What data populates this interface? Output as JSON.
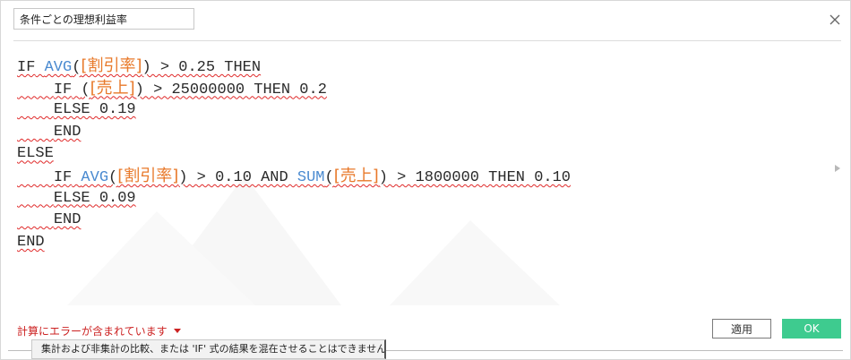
{
  "dialog": {
    "name_value": "条件ごとの理想利益率",
    "close_label": "×"
  },
  "code_lines": [
    [
      {
        "t": "IF",
        "c": "kw"
      },
      {
        "t": " "
      },
      {
        "t": "AVG",
        "c": "fn"
      },
      {
        "t": "(",
        "c": "kw"
      },
      {
        "t": "[割引率]",
        "c": "br"
      },
      {
        "t": ") > 0.25 THEN",
        "c": "kw"
      }
    ],
    [
      {
        "t": "    "
      },
      {
        "t": "IF",
        "c": "kw"
      },
      {
        "t": " "
      },
      {
        "t": "(",
        "c": "kw"
      },
      {
        "t": "[売上]",
        "c": "br"
      },
      {
        "t": ") > 25000000 THEN 0.2",
        "c": "kw"
      }
    ],
    [
      {
        "t": "    "
      },
      {
        "t": "ELSE 0.19",
        "c": "kw"
      }
    ],
    [
      {
        "t": "    "
      },
      {
        "t": "END",
        "c": "kw"
      }
    ],
    [
      {
        "t": "ELSE",
        "c": "kw"
      }
    ],
    [
      {
        "t": "    "
      },
      {
        "t": "IF",
        "c": "kw"
      },
      {
        "t": " "
      },
      {
        "t": "AVG",
        "c": "fn"
      },
      {
        "t": "(",
        "c": "kw"
      },
      {
        "t": "[割引率]",
        "c": "br"
      },
      {
        "t": ") > 0.10 AND ",
        "c": "kw"
      },
      {
        "t": "SUM",
        "c": "fn"
      },
      {
        "t": "(",
        "c": "kw"
      },
      {
        "t": "[売上]",
        "c": "br"
      },
      {
        "t": ") > 1800000 THEN 0.10",
        "c": "kw"
      }
    ],
    [
      {
        "t": "    "
      },
      {
        "t": "ELSE 0.09",
        "c": "kw"
      }
    ],
    [
      {
        "t": "    "
      },
      {
        "t": "END",
        "c": "kw"
      }
    ],
    [
      {
        "t": "END",
        "c": "kw"
      }
    ]
  ],
  "footer": {
    "error_label": "計算にエラーが含まれています",
    "apply_label": "適用",
    "ok_label": "OK",
    "tooltip": "集計および非集計の比較、または 'IF' 式の結果を混在させることはできません"
  },
  "colors": {
    "function": "#4a8ad0",
    "field": "#e8792a",
    "error": "#cc2222",
    "ok_button": "#3ecb8f"
  }
}
